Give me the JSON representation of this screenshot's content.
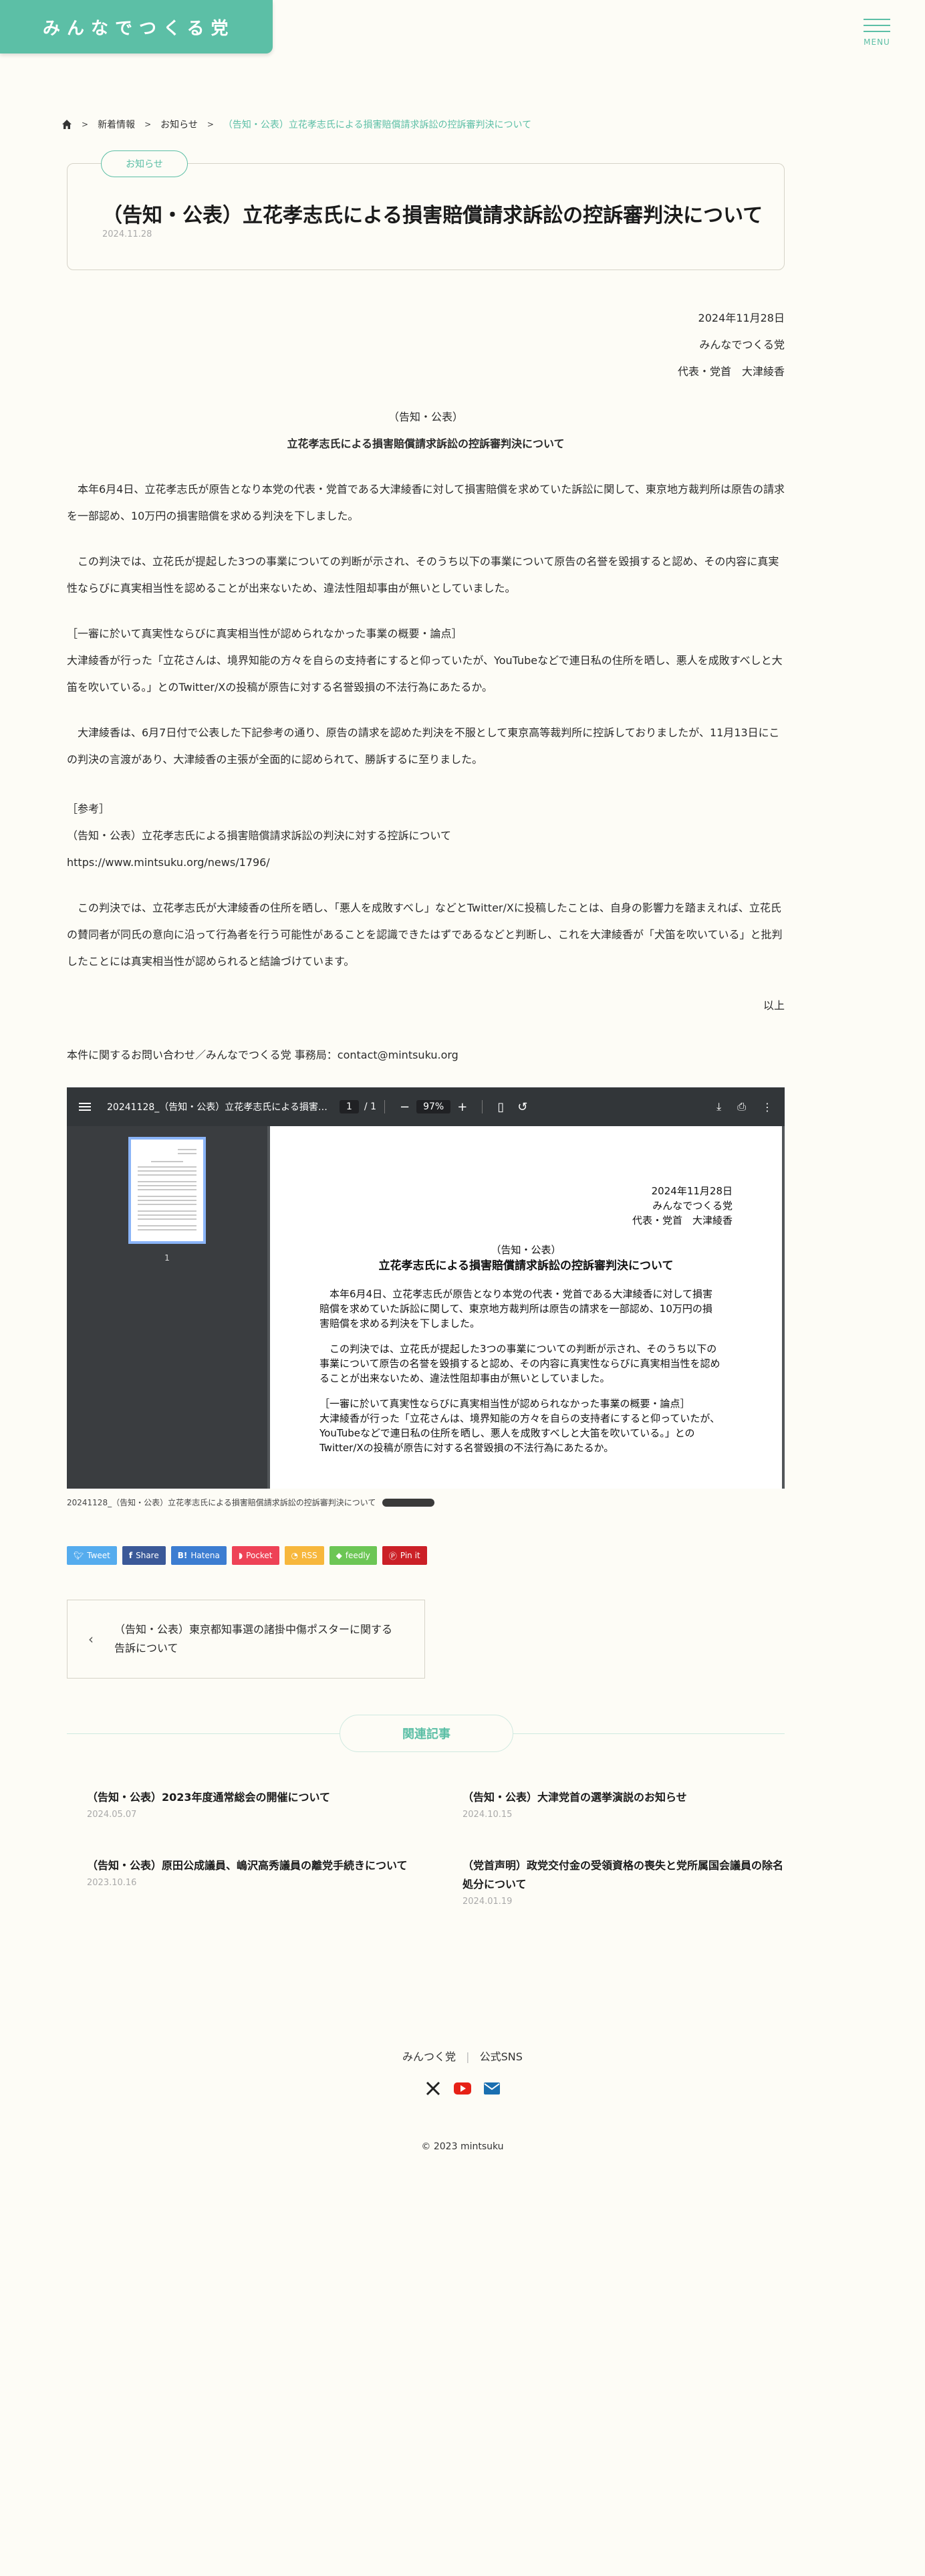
{
  "header": {
    "logo": "みんなでつくる党",
    "menu_label": "MENU"
  },
  "breadcrumb": {
    "items": [
      "新着情報",
      "お知らせ"
    ],
    "current": "（告知・公表）立花孝志氏による損害賠償請求訴訟の控訴審判決について"
  },
  "post": {
    "category": "お知らせ",
    "title": "（告知・公表）立花孝志氏による損害賠償請求訴訟の控訴審判決について",
    "date": "2024.11.28"
  },
  "letter": {
    "date": "2024年11月28日",
    "org": "みんなでつくる党",
    "rep": "代表・党首　大津綾香",
    "heading1": "（告知・公表）",
    "heading2": "立花孝志氏による損害賠償請求訴訟の控訴審判決について",
    "p1": "本年6月4日、立花孝志氏が原告となり本党の代表・党首である大津綾香に対して損害賠償を求めていた訴訟に関して、東京地方裁判所は原告の請求を一部認め、10万円の損害賠償を求める判決を下しました。",
    "p2": "この判決では、立花氏が提起した3つの事業についての判断が示され、そのうち以下の事業について原告の名誉を毀損すると認め、その内容に真実性ならびに真実相当性を認めることが出来ないため、違法性阻却事由が無いとしていました。",
    "p3_title": "［一審に於いて真実性ならびに真実相当性が認められなかった事業の概要・論点］",
    "p3": "大津綾香が行った「立花さんは、境界知能の方々を自らの支持者にすると仰っていたが、YouTubeなどで連日私の住所を晒し、悪人を成敗すべしと大笛を吹いている。」とのTwitter/Xの投稿が原告に対する名誉毀損の不法行為にあたるか。",
    "p4": "大津綾香は、6月7日付で公表した下記参考の通り、原告の請求を認めた判決を不服として東京高等裁判所に控訴しておりましたが、11月13日にこの判決の言渡があり、大津綾香の主張が全面的に認められて、勝訴するに至りました。",
    "ref_label": "［参考］",
    "ref_title": "（告知・公表）立花孝志氏による損害賠償請求訴訟の判決に対する控訴について",
    "ref_url": "https://www.mintsuku.org/news/1796/",
    "p5": "この判決では、立花孝志氏が大津綾香の住所を晒し、「悪人を成敗すべし」などとTwitter/Xに投稿したことは、自身の影響力を踏まえれば、立花氏の賛同者が同氏の意向に沿って行為者を行う可能性があることを認識できたはずであるなどと判断し、これを大津綾香が「犬笛を吹いている」と批判したことには真実相当性が認められると結論づけています。",
    "closing": "以上",
    "contact": "本件に関するお問い合わせ／みんなでつくる党 事務局：contact@mintsuku.org"
  },
  "pdf": {
    "filename": "20241128_（告知・公表）立花孝志氏による損害…",
    "page": "1",
    "total": "/ 1",
    "zoom": "97%",
    "thumb_num": "1",
    "date": "2024年11月28日",
    "org": "みんなでつくる党",
    "rep": "代表・党首　大津綾香",
    "h1": "（告知・公表）",
    "h2": "立花孝志氏による損害賠償請求訴訟の控訴審判決について",
    "l1": "本年6月4日、立花孝志氏が原告となり本党の代表・党首である大津綾香に対して損害",
    "l2": "賠償を求めていた訴訟に関して、東京地方裁判所は原告の請求を一部認め、10万円の損",
    "l3": "害賠償を求める判決を下しました。",
    "l4": "この判決では、立花氏が提起した3つの事業についての判断が示され、そのうち以下の",
    "l5": "事業について原告の名誉を毀損すると認め、その内容に真実性ならびに真実相当性を認め",
    "l6": "ることが出来ないため、違法性阻却事由が無いとしていました。",
    "l7": "［一審に於いて真実性ならびに真実相当性が認められなかった事業の概要・論点］",
    "l8": "大津綾香が行った「立花さんは、境界知能の方々を自らの支持者にすると仰っていたが、",
    "l9": "YouTubeなどで連日私の住所を晒し、悪人を成敗すべしと大笛を吹いている。」との",
    "l10": "Twitter/Xの投稿が原告に対する名誉毀損の不法行為にあたるか。",
    "caption": "20241128_（告知・公表）立花孝志氏による損害賠償請求訴訟の控訴審判決について"
  },
  "shares": [
    {
      "label": "Tweet",
      "color": "#55acee",
      "icon": "twitter-icon"
    },
    {
      "label": "Share",
      "color": "#3b5998",
      "icon": "facebook-icon"
    },
    {
      "label": "Hatena",
      "color": "#3c7dd1",
      "icon": "hatena-icon"
    },
    {
      "label": "Pocket",
      "color": "#ee4256",
      "icon": "pocket-icon"
    },
    {
      "label": "RSS",
      "color": "#f7b73c",
      "icon": "rss-icon"
    },
    {
      "label": "feedly",
      "color": "#6cc655",
      "icon": "feedly-icon"
    },
    {
      "label": "Pin it",
      "color": "#cb2027",
      "icon": "pinterest-icon"
    }
  ],
  "prev_post": {
    "line1": "（告知・公表）東京都知事選の諸掛中傷ポスターに関する",
    "line2": "告訴について"
  },
  "related": {
    "heading": "関連記事",
    "items": [
      {
        "title": "（告知・公表）2023年度通常総会の開催について",
        "date": "2024.05.07"
      },
      {
        "title": "（告知・公表）大津党首の選挙演説のお知らせ",
        "date": "2024.10.15"
      },
      {
        "title": "（告知・公表）原田公成議員、嶋沢高秀議員の離党手続きについて",
        "date": "2023.10.16"
      },
      {
        "title": "（党首声明）政党交付金の受領資格の喪失と党所属国会議員の除名処分について",
        "date": "2024.01.19"
      }
    ]
  },
  "footer": {
    "link1": "みんつく党",
    "divider": "|",
    "link2": "公式SNS",
    "copyright": "© 2023 mintsuku"
  },
  "colors": {
    "accent": "#5cbfa6",
    "background": "#fdfcf6"
  }
}
